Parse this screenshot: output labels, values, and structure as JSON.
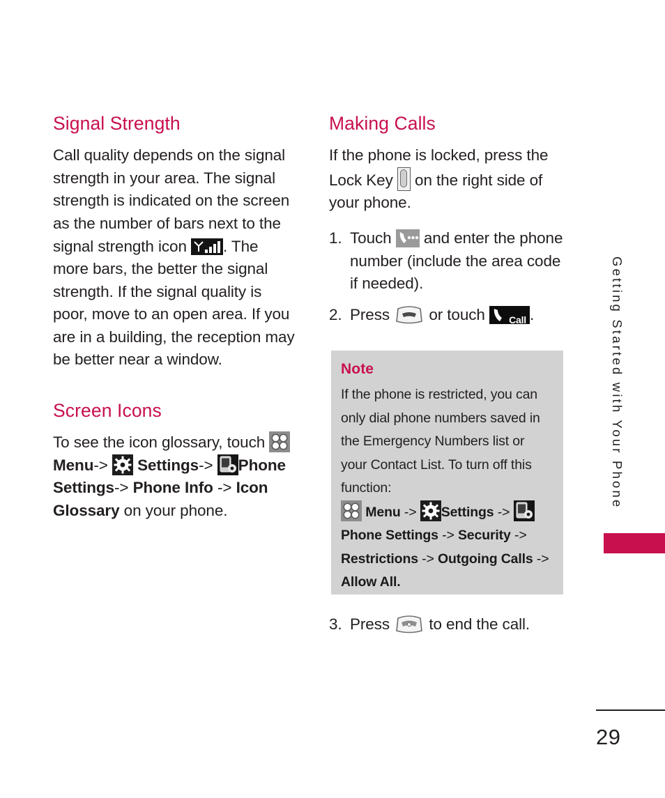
{
  "page": {
    "number": "29",
    "side_tab_label": "Getting Started with Your Phone",
    "accent_color": "#c8104e",
    "note_bg_color": "#d2d2d2"
  },
  "left_column": {
    "section1": {
      "title": "Signal Strength",
      "text_before_icon": "Call quality depends on the signal strength in your area. The signal strength is indicated on the screen as the number of bars next to the signal strength icon ",
      "icon": "signal-strength-icon",
      "text_after_icon": ". The more bars, the better the signal strength. If the signal quality is poor, move to an open area. If you are in a building, the reception may be better near a window."
    },
    "section2": {
      "title": "Screen Icons",
      "intro": "To see the icon glossary, touch ",
      "path": [
        {
          "type": "icon",
          "value": "menu-grid-icon"
        },
        {
          "type": "bold",
          "value": "Menu"
        },
        {
          "type": "text",
          "value": "-> "
        },
        {
          "type": "icon",
          "value": "settings-gear-icon"
        },
        {
          "type": "bold",
          "value": "Settings"
        },
        {
          "type": "text",
          "value": "-> "
        },
        {
          "type": "icon",
          "value": "phone-settings-icon"
        },
        {
          "type": "bold",
          "value": "Phone Settings"
        },
        {
          "type": "text",
          "value": "-> "
        },
        {
          "type": "bold",
          "value": "Phone Info"
        },
        {
          "type": "text",
          "value": " -> "
        },
        {
          "type": "bold",
          "value": "Icon Glossary"
        },
        {
          "type": "text",
          "value": " on your phone."
        }
      ]
    }
  },
  "right_column": {
    "title": "Making Calls",
    "intro_before_icon": "If the phone is locked, press the Lock Key ",
    "lock_key_icon": "lock-key-icon",
    "intro_after_icon": " on the right side of your phone.",
    "steps": [
      {
        "number": "1.",
        "text_before_icon": "Touch ",
        "icon": "dialpad-touch-icon",
        "text_after_icon": " and enter the phone number (include the area code if needed)."
      },
      {
        "number": "2.",
        "text_before_icon": "Press ",
        "icon": "send-key-icon",
        "text_middle": " or touch ",
        "icon2": "call-button-icon",
        "call_label": "Call",
        "text_after_icon": "."
      },
      {
        "number": "3.",
        "text_before_icon": "Press ",
        "icon": "end-key-icon",
        "text_after_icon": " to end the call."
      }
    ],
    "note": {
      "title": "Note",
      "body": "If the phone is restricted, you can only dial phone numbers saved in the Emergency Numbers list or your Contact List. To turn off this function:",
      "path": [
        {
          "type": "icon",
          "value": "menu-grid-icon"
        },
        {
          "type": "bold",
          "value": "Menu"
        },
        {
          "type": "text",
          "value": " -> "
        },
        {
          "type": "icon",
          "value": "settings-gear-icon"
        },
        {
          "type": "bold",
          "value": "Settings"
        },
        {
          "type": "text",
          "value": " -> "
        },
        {
          "type": "icon",
          "value": "phone-settings-icon"
        },
        {
          "type": "bold",
          "value": "Phone Settings"
        },
        {
          "type": "text",
          "value": " -> "
        },
        {
          "type": "bold",
          "value": "Security"
        },
        {
          "type": "text",
          "value": " -> "
        },
        {
          "type": "bold",
          "value": "Restrictions"
        },
        {
          "type": "text",
          "value": " -> "
        },
        {
          "type": "bold",
          "value": "Outgoing Calls"
        },
        {
          "type": "text",
          "value": " -> "
        },
        {
          "type": "bold",
          "value": "Allow All."
        }
      ]
    }
  }
}
